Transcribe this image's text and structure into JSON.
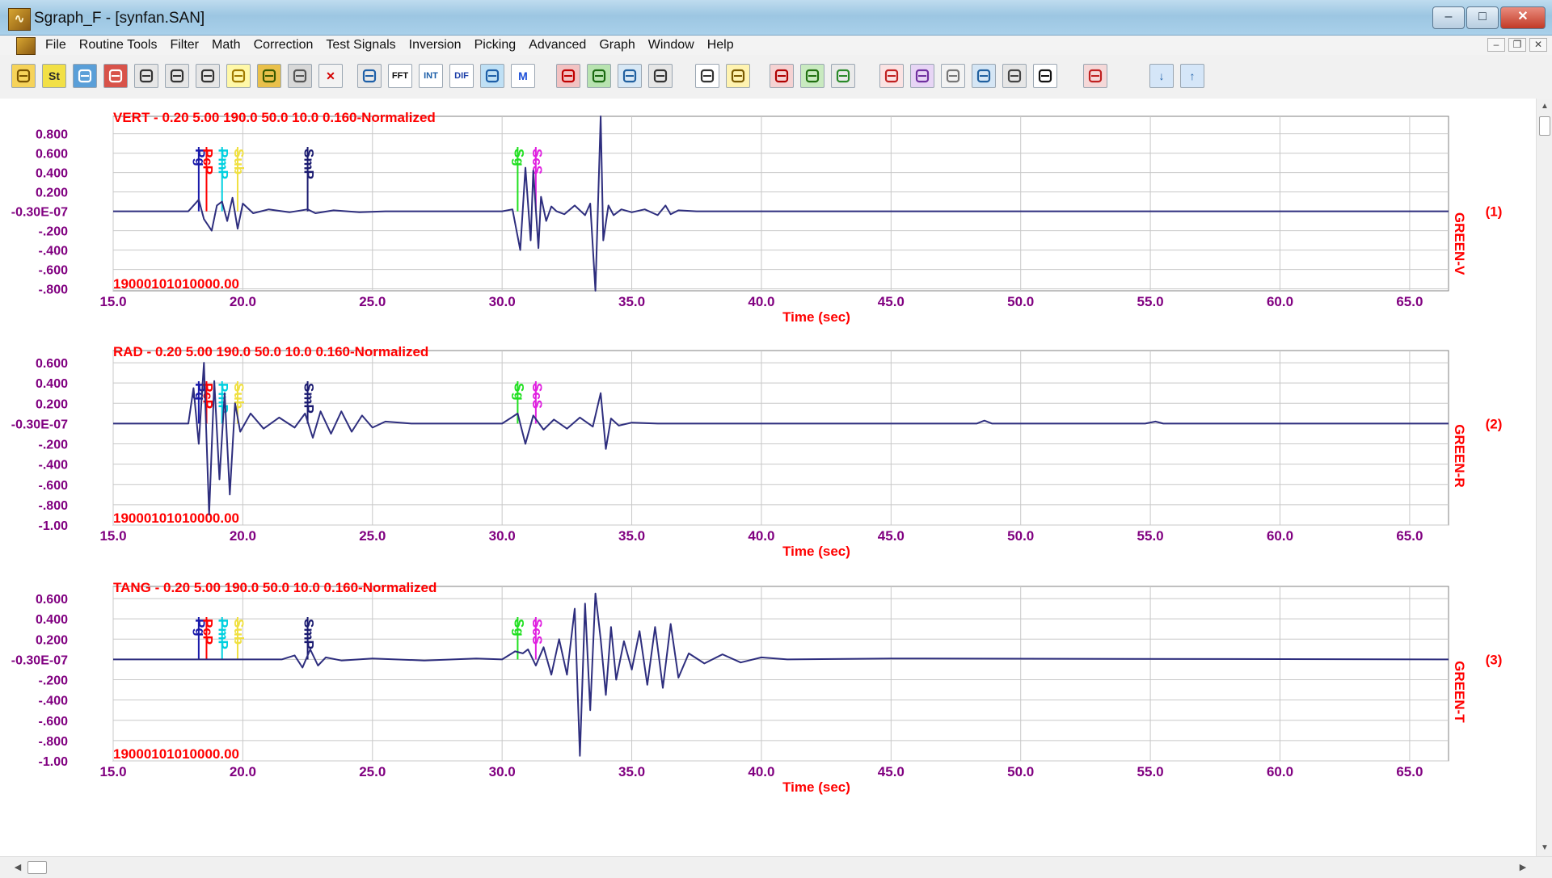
{
  "window": {
    "title": "Sgraph_F - [synfan.SAN]",
    "app_icon": "seismograph-app-icon",
    "minimize_glyph": "‒",
    "maximize_glyph": "□",
    "close_glyph": "✕",
    "mdi_minimize_glyph": "–",
    "mdi_restore_glyph": "❐",
    "mdi_close_glyph": "✕"
  },
  "menu": {
    "items": [
      "File",
      "Routine Tools",
      "Filter",
      "Math",
      "Correction",
      "Test Signals",
      "Inversion",
      "Picking",
      "Advanced",
      "Graph",
      "Window",
      "Help"
    ]
  },
  "toolbar": {
    "buttons": [
      {
        "icon": "open-folder-icon",
        "text": "",
        "bg": "#f6d35a",
        "fg": "#7a5400"
      },
      {
        "icon": "station-icon",
        "text": "St",
        "bg": "#f2e046",
        "fg": "#2a2a2a"
      },
      {
        "icon": "seismogram-icon",
        "text": "",
        "bg": "#5a9fd8",
        "fg": "#ffffff"
      },
      {
        "icon": "network-icon",
        "text": "",
        "bg": "#d8534a",
        "fg": "#ffffff"
      },
      {
        "icon": "save-icon",
        "text": "",
        "bg": "#e6e6e6",
        "fg": "#333333"
      },
      {
        "icon": "save-all-icon",
        "text": "",
        "bg": "#e6e6e6",
        "fg": "#333333"
      },
      {
        "icon": "print-icon",
        "text": "",
        "bg": "#e6e6e6",
        "fg": "#333333"
      },
      {
        "icon": "bulb-icon",
        "text": "",
        "bg": "#fff8a8",
        "fg": "#a07a00"
      },
      {
        "icon": "eraser-icon",
        "text": "",
        "bg": "#e9c04b",
        "fg": "#3a5a00"
      },
      {
        "icon": "wrench-icon",
        "text": "",
        "bg": "#d8d8d8",
        "fg": "#555555"
      },
      {
        "icon": "delete-icon",
        "text": "✕",
        "bg": "#f3f3f3",
        "fg": "#d40000"
      },
      {
        "icon": "zoom-icon",
        "text": "",
        "bg": "#e8e8e8",
        "fg": "#1d5fa8"
      },
      {
        "icon": "fft-icon",
        "text": "FFT",
        "bg": "#ffffff",
        "fg": "#111111"
      },
      {
        "icon": "integrate-icon",
        "text": "INT",
        "bg": "#ffffff",
        "fg": "#1d5fa8"
      },
      {
        "icon": "differentiate-icon",
        "text": "DIF",
        "bg": "#ffffff",
        "fg": "#1d3fa8"
      },
      {
        "icon": "refresh-icon",
        "text": "",
        "bg": "#bfe0f5",
        "fg": "#1d5fa8"
      },
      {
        "icon": "m-icon",
        "text": "M",
        "bg": "#ffffff",
        "fg": "#1d4fd8"
      },
      {
        "icon": "filter-icon",
        "text": "",
        "bg": "#f2c2c2",
        "fg": "#c00000"
      },
      {
        "icon": "add-trace-icon",
        "text": "",
        "bg": "#b8e3b0",
        "fg": "#1a6a10"
      },
      {
        "icon": "swap-icon",
        "text": "",
        "bg": "#d8e8f5",
        "fg": "#2060a0"
      },
      {
        "icon": "calculator-icon",
        "text": "",
        "bg": "#e6e6e6",
        "fg": "#333333"
      },
      {
        "icon": "scale-icon",
        "text": "",
        "bg": "#ffffff",
        "fg": "#333333"
      },
      {
        "icon": "measure-icon",
        "text": "",
        "bg": "#fff3b0",
        "fg": "#7a5a00"
      },
      {
        "icon": "pick-red-icon",
        "text": "",
        "bg": "#f5d2d2",
        "fg": "#b00000"
      },
      {
        "icon": "pick-green-icon",
        "text": "",
        "bg": "#c9eac0",
        "fg": "#207010"
      },
      {
        "icon": "circle-icon",
        "text": "",
        "bg": "#eaeaea",
        "fg": "#2a8a2a"
      },
      {
        "icon": "spectrum-icon",
        "text": "",
        "bg": "#fbe3e3",
        "fg": "#c02020"
      },
      {
        "icon": "multi-spectrum-icon",
        "text": "",
        "bg": "#e7d5f5",
        "fg": "#7030a0"
      },
      {
        "icon": "dashed-box-icon",
        "text": "",
        "bg": "#f3f3f3",
        "fg": "#777777"
      },
      {
        "icon": "arrows-lr-icon",
        "text": "",
        "bg": "#d5e6f5",
        "fg": "#2060a0"
      },
      {
        "icon": "monitor-icon",
        "text": "",
        "bg": "#e6e6e6",
        "fg": "#444444"
      },
      {
        "icon": "beachball-icon",
        "text": "",
        "bg": "#ffffff",
        "fg": "#111111"
      },
      {
        "icon": "polar-icon",
        "text": "",
        "bg": "#f5d8d8",
        "fg": "#c02020"
      },
      {
        "icon": "arrow-down-icon",
        "text": "↓",
        "bg": "#d5e6f8",
        "fg": "#1d5fa8"
      },
      {
        "icon": "arrow-up-icon",
        "text": "↑",
        "bg": "#d5e6f8",
        "fg": "#1d5fa8"
      }
    ]
  },
  "colors": {
    "trace": "#2e2e7e",
    "grid": "#c8c8c8",
    "axis": "#808080",
    "tick_label": "#800080",
    "header": "#ff0000",
    "pick_Pg": "#1a1aaa",
    "pick_PcP": "#ff0000",
    "pick_PmP": "#00d0e0",
    "pick_Sub": "#f0e040",
    "pick_SmP": "#1a1a70",
    "pick_Sg": "#20e020",
    "pick_ScS": "#e020e0"
  },
  "chart_data": [
    {
      "type": "line",
      "panel_number": "(1)",
      "header": "VERT - 0.20 5.00 190.0 50.0 10.0 0.160-Normalized",
      "timestamp": "19000101010000.00",
      "channel": "GREEN-V",
      "xlabel": "Time (sec)",
      "xlim": [
        15.0,
        66.5
      ],
      "ylim": [
        -0.82,
        0.98
      ],
      "xticks": [
        "15.0",
        "20.0",
        "25.0",
        "30.0",
        "35.0",
        "40.0",
        "45.0",
        "50.0",
        "55.0",
        "60.0",
        "65.0"
      ],
      "yticks": [
        {
          "value": 0.8,
          "label": "0.800"
        },
        {
          "value": 0.6,
          "label": "0.600"
        },
        {
          "value": 0.4,
          "label": "0.400"
        },
        {
          "value": 0.2,
          "label": "0.200"
        },
        {
          "value": 0.0,
          "label": "-0.30E-07"
        },
        {
          "value": -0.2,
          "label": "-.200"
        },
        {
          "value": -0.4,
          "label": "-.400"
        },
        {
          "value": -0.6,
          "label": "-.600"
        },
        {
          "value": -0.8,
          "label": "-.800"
        }
      ],
      "picks": [
        {
          "label": "Pg",
          "time": 18.3,
          "color": "#1a1aaa"
        },
        {
          "label": "PcP",
          "time": 18.6,
          "color": "#ff0000"
        },
        {
          "label": "PmP",
          "time": 19.2,
          "color": "#00d0e0"
        },
        {
          "label": "Sub",
          "time": 19.8,
          "color": "#f0e040"
        },
        {
          "label": "SmP",
          "time": 22.5,
          "color": "#1a1a70"
        },
        {
          "label": "Sg",
          "time": 30.6,
          "color": "#20e020"
        },
        {
          "label": "ScS",
          "time": 31.3,
          "color": "#e020e0"
        }
      ],
      "series": [
        {
          "x": [
            15.0,
            17.9,
            18.3,
            18.5,
            18.8,
            19.0,
            19.2,
            19.4,
            19.6,
            19.8,
            20.0,
            20.4,
            21.0,
            21.8,
            22.5,
            22.8,
            23.5,
            24.5,
            25.5,
            30.0,
            30.4,
            30.7,
            30.9,
            31.1,
            31.2,
            31.4,
            31.5,
            31.7,
            31.9,
            32.1,
            32.4,
            32.8,
            33.2,
            33.4,
            33.6,
            33.8,
            33.9,
            34.1,
            34.3,
            34.6,
            35.0,
            35.5,
            36.0,
            36.3,
            36.5,
            36.8,
            37.5,
            38.0,
            66.5
          ],
          "y": [
            0.0,
            0.0,
            0.12,
            -0.08,
            -0.2,
            0.06,
            0.1,
            -0.1,
            0.14,
            -0.18,
            0.08,
            -0.02,
            0.02,
            -0.01,
            0.02,
            -0.02,
            0.01,
            -0.01,
            0.0,
            0.0,
            0.02,
            -0.4,
            0.45,
            -0.3,
            0.42,
            -0.38,
            0.15,
            -0.1,
            0.05,
            0.0,
            -0.03,
            0.06,
            -0.04,
            0.08,
            -0.82,
            0.98,
            -0.3,
            0.06,
            -0.04,
            0.02,
            -0.01,
            0.02,
            -0.04,
            0.06,
            -0.03,
            0.01,
            0.0,
            0.0,
            0.0
          ]
        }
      ]
    },
    {
      "type": "line",
      "panel_number": "(2)",
      "header": "RAD - 0.20 5.00 190.0 50.0 10.0 0.160-Normalized",
      "timestamp": "19000101010000.00",
      "channel": "GREEN-R",
      "xlabel": "Time (sec)",
      "xlim": [
        15.0,
        66.5
      ],
      "ylim": [
        -1.0,
        0.72
      ],
      "xticks": [
        "15.0",
        "20.0",
        "25.0",
        "30.0",
        "35.0",
        "40.0",
        "45.0",
        "50.0",
        "55.0",
        "60.0",
        "65.0"
      ],
      "yticks": [
        {
          "value": 0.6,
          "label": "0.600"
        },
        {
          "value": 0.4,
          "label": "0.400"
        },
        {
          "value": 0.2,
          "label": "0.200"
        },
        {
          "value": 0.0,
          "label": "-0.30E-07"
        },
        {
          "value": -0.2,
          "label": "-.200"
        },
        {
          "value": -0.4,
          "label": "-.400"
        },
        {
          "value": -0.6,
          "label": "-.600"
        },
        {
          "value": -0.8,
          "label": "-.800"
        },
        {
          "value": -1.0,
          "label": "-1.00"
        }
      ],
      "picks": [
        {
          "label": "Pg",
          "time": 18.3,
          "color": "#1a1aaa"
        },
        {
          "label": "PcP",
          "time": 18.6,
          "color": "#ff0000"
        },
        {
          "label": "PmP",
          "time": 19.2,
          "color": "#00d0e0"
        },
        {
          "label": "Sub",
          "time": 19.8,
          "color": "#f0e040"
        },
        {
          "label": "SmP",
          "time": 22.5,
          "color": "#1a1a70"
        },
        {
          "label": "Sg",
          "time": 30.6,
          "color": "#20e020"
        },
        {
          "label": "ScS",
          "time": 31.3,
          "color": "#e020e0"
        }
      ],
      "series": [
        {
          "x": [
            15.0,
            17.9,
            18.1,
            18.3,
            18.5,
            18.7,
            18.9,
            19.1,
            19.3,
            19.5,
            19.7,
            19.9,
            20.3,
            20.8,
            21.4,
            22.0,
            22.4,
            22.7,
            23.0,
            23.4,
            23.8,
            24.2,
            24.6,
            25.0,
            25.5,
            26.5,
            30.0,
            30.6,
            30.9,
            31.2,
            31.6,
            32.0,
            32.5,
            33.0,
            33.5,
            33.8,
            34.0,
            34.2,
            34.5,
            35.0,
            36.0,
            48.3,
            48.6,
            48.9,
            54.8,
            55.2,
            55.5,
            66.5
          ],
          "y": [
            0.0,
            0.0,
            0.35,
            -0.2,
            0.6,
            -0.9,
            0.42,
            -0.55,
            0.3,
            -0.7,
            0.2,
            -0.08,
            0.1,
            -0.05,
            0.06,
            -0.04,
            0.1,
            -0.14,
            0.12,
            -0.1,
            0.12,
            -0.08,
            0.08,
            -0.04,
            0.02,
            0.0,
            0.0,
            0.1,
            -0.2,
            0.08,
            -0.06,
            0.04,
            -0.05,
            0.06,
            -0.03,
            0.3,
            -0.25,
            0.05,
            -0.02,
            0.01,
            0.0,
            0.0,
            0.03,
            0.0,
            0.0,
            0.02,
            0.0,
            0.0
          ]
        }
      ]
    },
    {
      "type": "line",
      "panel_number": "(3)",
      "header": "TANG - 0.20 5.00 190.0 50.0 10.0 0.160-Normalized",
      "timestamp": "19000101010000.00",
      "channel": "GREEN-T",
      "xlabel": "Time (sec)",
      "xlim": [
        15.0,
        66.5
      ],
      "ylim": [
        -1.0,
        0.72
      ],
      "xticks": [
        "15.0",
        "20.0",
        "25.0",
        "30.0",
        "35.0",
        "40.0",
        "45.0",
        "50.0",
        "55.0",
        "60.0",
        "65.0"
      ],
      "yticks": [
        {
          "value": 0.6,
          "label": "0.600"
        },
        {
          "value": 0.4,
          "label": "0.400"
        },
        {
          "value": 0.2,
          "label": "0.200"
        },
        {
          "value": 0.0,
          "label": "-0.30E-07"
        },
        {
          "value": -0.2,
          "label": "-.200"
        },
        {
          "value": -0.4,
          "label": "-.400"
        },
        {
          "value": -0.6,
          "label": "-.600"
        },
        {
          "value": -0.8,
          "label": "-.800"
        },
        {
          "value": -1.0,
          "label": "-1.00"
        }
      ],
      "picks": [
        {
          "label": "Pg",
          "time": 18.3,
          "color": "#1a1aaa"
        },
        {
          "label": "PcP",
          "time": 18.6,
          "color": "#ff0000"
        },
        {
          "label": "PmP",
          "time": 19.2,
          "color": "#00d0e0"
        },
        {
          "label": "Sub",
          "time": 19.8,
          "color": "#f0e040"
        },
        {
          "label": "SmP",
          "time": 22.5,
          "color": "#1a1a70"
        },
        {
          "label": "Sg",
          "time": 30.6,
          "color": "#20e020"
        },
        {
          "label": "ScS",
          "time": 31.3,
          "color": "#e020e0"
        }
      ],
      "series": [
        {
          "x": [
            15.0,
            21.5,
            22.0,
            22.3,
            22.6,
            22.9,
            23.2,
            23.8,
            25.0,
            27.0,
            29.0,
            30.0,
            30.5,
            30.8,
            31.0,
            31.3,
            31.6,
            31.9,
            32.2,
            32.5,
            32.8,
            33.0,
            33.2,
            33.4,
            33.6,
            33.8,
            34.0,
            34.2,
            34.4,
            34.7,
            35.0,
            35.3,
            35.6,
            35.9,
            36.2,
            36.5,
            36.8,
            37.2,
            37.8,
            38.5,
            39.2,
            40.0,
            41.0,
            45.0,
            66.5
          ],
          "y": [
            0.0,
            0.0,
            0.04,
            -0.08,
            0.1,
            -0.06,
            0.02,
            -0.01,
            0.01,
            -0.01,
            0.01,
            0.0,
            0.08,
            0.06,
            0.1,
            -0.06,
            0.12,
            -0.15,
            0.2,
            -0.15,
            0.5,
            -0.95,
            0.55,
            -0.5,
            0.65,
            0.2,
            -0.35,
            0.32,
            -0.2,
            0.18,
            -0.1,
            0.28,
            -0.25,
            0.32,
            -0.28,
            0.35,
            -0.18,
            0.06,
            -0.04,
            0.05,
            -0.03,
            0.02,
            0.0,
            0.01,
            0.0
          ]
        }
      ]
    }
  ]
}
